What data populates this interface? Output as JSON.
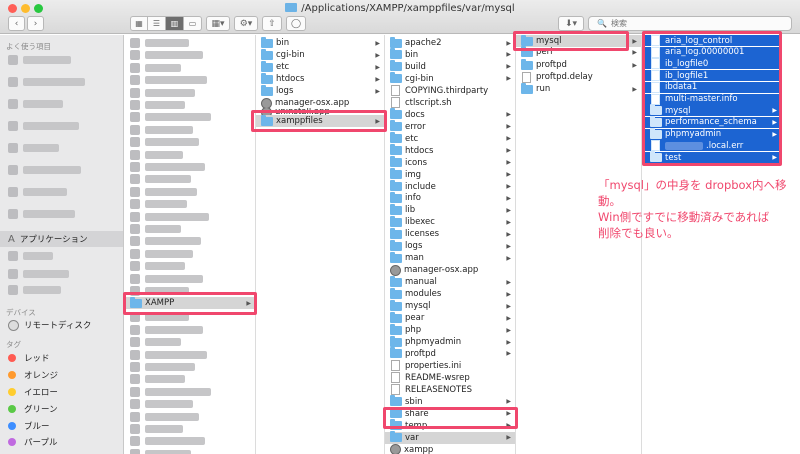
{
  "window": {
    "title": "/Applications/XAMPP/xamppfiles/var/mysql"
  },
  "toolbar": {
    "back": "‹",
    "forward": "›",
    "views": [
      "▦",
      "☰",
      "▥",
      "▭"
    ],
    "arrange": "▦▾",
    "action": "⚙▾",
    "share": "⇧",
    "tags": "◯",
    "dropbox": "⬇▾",
    "search_placeholder": "検索"
  },
  "sidebar": {
    "favorites_heading": "よく使う項目",
    "applications": "アプリケーション",
    "devices_heading": "デバイス",
    "remote_disc": "リモートディスク",
    "tags_heading": "タグ",
    "tags": [
      {
        "label": "レッド",
        "color": "#ff5b52"
      },
      {
        "label": "オレンジ",
        "color": "#ff9a2e"
      },
      {
        "label": "イエロー",
        "color": "#ffcd2e"
      },
      {
        "label": "グリーン",
        "color": "#5ac946"
      },
      {
        "label": "ブルー",
        "color": "#3d8eff"
      },
      {
        "label": "パープル",
        "color": "#c06ae0"
      }
    ]
  },
  "col1": {
    "xampp": "XAMPP"
  },
  "col2": {
    "items": [
      "bin",
      "cgi-bin",
      "etc",
      "htdocs",
      "logs",
      "manager-osx.app",
      "uninstall.app",
      "xamppfiles"
    ]
  },
  "col3": {
    "items": [
      "apache2",
      "bin",
      "build",
      "cgi-bin",
      "COPYING.thirdparty",
      "ctlscript.sh",
      "docs",
      "error",
      "etc",
      "htdocs",
      "icons",
      "img",
      "include",
      "info",
      "lib",
      "libexec",
      "licenses",
      "logs",
      "man",
      "manager-osx.app",
      "manual",
      "modules",
      "mysql",
      "pear",
      "php",
      "phpmyadmin",
      "proftpd",
      "properties.ini",
      "README-wsrep",
      "RELEASENOTES",
      "sbin",
      "share",
      "temp",
      "var",
      "xampp"
    ]
  },
  "col4": {
    "items": [
      "mysql",
      "perl",
      "proftpd",
      "proftpd.delay",
      "run"
    ]
  },
  "col5": {
    "items": [
      "aria_log_control",
      "aria_log.00000001",
      "ib_logfile0",
      "ib_logfile1",
      "ibdata1",
      "multi-master.info",
      "mysql",
      "performance_schema",
      "phpmyadmin",
      ".local.err",
      "test"
    ]
  },
  "annotation": {
    "text": "「mysql」の中身を dropbox内へ移動。\nWin側ですでに移動済みであれば\n削除でも良い。"
  },
  "colors": {
    "highlight": "#f0476d",
    "selection": "#1c64d2"
  }
}
